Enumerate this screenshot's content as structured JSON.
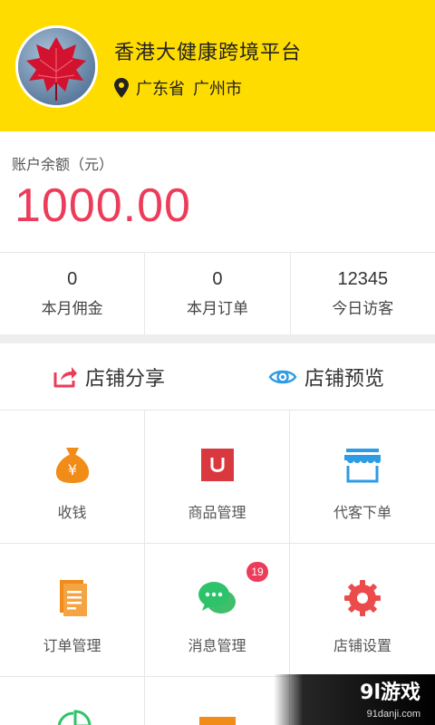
{
  "header": {
    "shop_name": "香港大健康跨境平台",
    "province": "广东省",
    "city": "广州市",
    "bg_color": "#ffdc00"
  },
  "balance": {
    "label": "账户余额（元）",
    "value": "1000.00",
    "value_color": "#ec3c5a"
  },
  "stats": [
    {
      "value": "0",
      "label": "本月佣金"
    },
    {
      "value": "0",
      "label": "本月订单"
    },
    {
      "value": "12345",
      "label": "今日访客"
    }
  ],
  "actions": [
    {
      "label": "店铺分享",
      "icon": "share-icon"
    },
    {
      "label": "店铺预览",
      "icon": "eye-icon"
    }
  ],
  "grid": [
    {
      "label": "收钱",
      "icon": "money-bag-icon"
    },
    {
      "label": "商品管理",
      "icon": "product-icon"
    },
    {
      "label": "代客下单",
      "icon": "storefront-icon"
    },
    {
      "label": "订单管理",
      "icon": "orders-icon"
    },
    {
      "label": "消息管理",
      "icon": "chat-icon",
      "badge": "19"
    },
    {
      "label": "店铺设置",
      "icon": "gear-icon"
    }
  ],
  "watermark": {
    "main": "9l游戏",
    "sub": "91danji.com"
  }
}
